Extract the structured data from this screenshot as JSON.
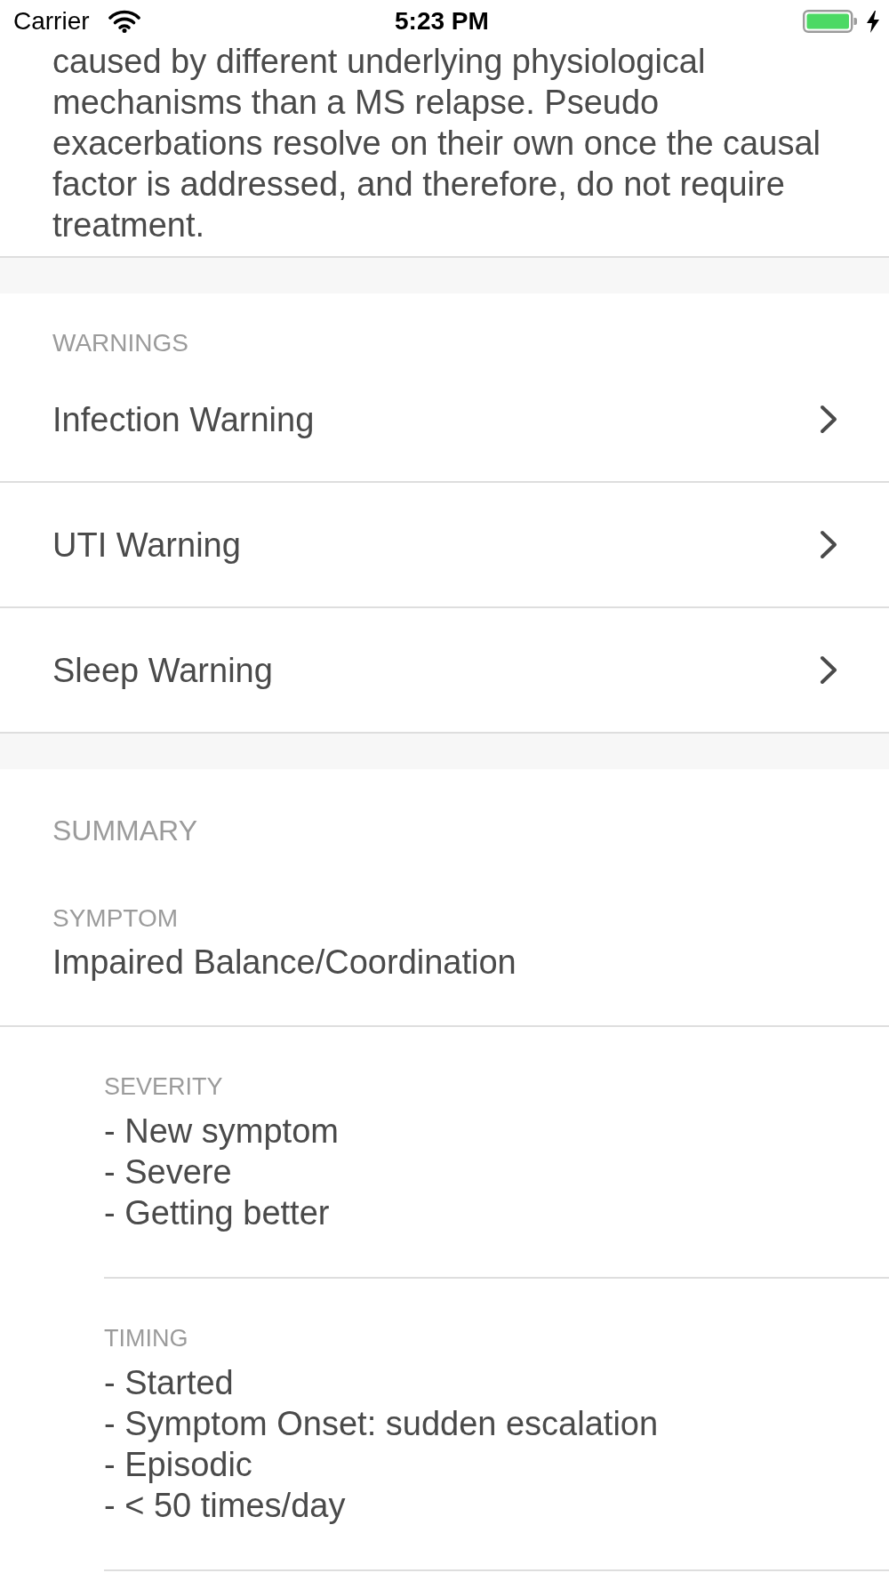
{
  "status_bar": {
    "carrier": "Carrier",
    "time": "5:23 PM",
    "charging": true
  },
  "description": {
    "text": "caused by different underlying physiological mechanisms than a MS relapse. Pseudo exacerbations resolve on their own once the causal factor is addressed, and therefore, do not require treatment."
  },
  "sections": [
    {
      "kind": "links",
      "header": "WARNINGS",
      "items": [
        {
          "label": "Infection Warning"
        },
        {
          "label": "UTI Warning"
        },
        {
          "label": "Sleep Warning"
        }
      ]
    },
    {
      "kind": "summary",
      "header": "SUMMARY",
      "fields": [
        {
          "label": "SYMPTOM",
          "value": "Impaired Balance/Coordination"
        }
      ],
      "details": [
        {
          "label": "SEVERITY",
          "lines": [
            "- New symptom",
            "- Severe",
            "- Getting better"
          ]
        },
        {
          "label": "TIMING",
          "lines": [
            "- Started",
            "- Symptom Onset: sudden escalation",
            "- Episodic",
            "- < 50 times/day"
          ]
        }
      ]
    }
  ]
}
